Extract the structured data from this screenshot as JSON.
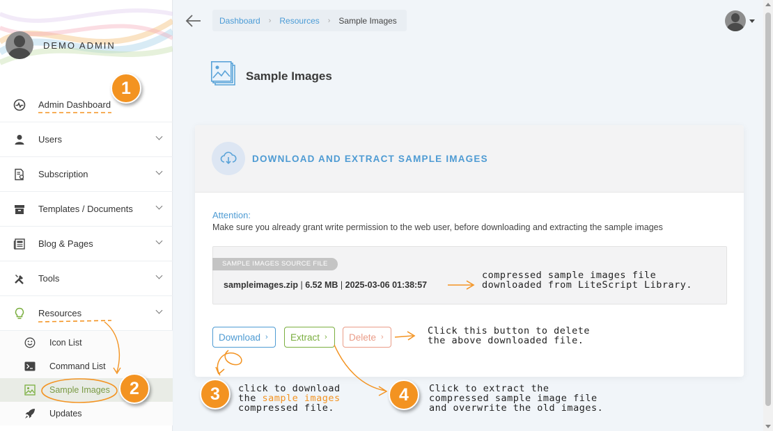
{
  "sidebar": {
    "profile_name": "DEMO ADMIN",
    "items": [
      {
        "label": "Admin Dashboard",
        "icon": "dashboard-icon"
      },
      {
        "label": "Users",
        "icon": "user-icon"
      },
      {
        "label": "Subscription",
        "icon": "subscription-icon"
      },
      {
        "label": "Templates / Documents",
        "icon": "archive-icon"
      },
      {
        "label": "Blog & Pages",
        "icon": "newspaper-icon"
      },
      {
        "label": "Tools",
        "icon": "tools-icon"
      },
      {
        "label": "Resources",
        "icon": "lightbulb-icon"
      }
    ],
    "sub_items": [
      {
        "label": "Icon List",
        "icon": "smiley-icon"
      },
      {
        "label": "Command List",
        "icon": "terminal-icon"
      },
      {
        "label": "Sample Images",
        "icon": "image-icon"
      },
      {
        "label": "Updates",
        "icon": "rocket-icon"
      }
    ]
  },
  "breadcrumb": {
    "items": [
      "Dashboard",
      "Resources"
    ],
    "current": "Sample Images"
  },
  "page": {
    "title": "Sample Images"
  },
  "card": {
    "title": "DOWNLOAD AND EXTRACT SAMPLE IMAGES",
    "attention_label": "Attention:",
    "attention_message": "Make sure you already grant write permission to the web user, before downloading and extracting the sample images",
    "source_tag": "SAMPLE IMAGES SOURCE FILE",
    "file_name": "sampleimages.zip",
    "file_size": "6.52 MB",
    "file_date": "2025-03-06 01:38:57",
    "buttons": {
      "download": "Download",
      "extract": "Extract",
      "delete": "Delete"
    }
  },
  "annotations": {
    "badges": [
      "1",
      "2",
      "3",
      "4"
    ],
    "file_note": [
      "compressed sample images file",
      "downloaded from LiteScript Library."
    ],
    "delete_note": [
      "Click this button to delete",
      "the above downloaded file."
    ],
    "download_note": {
      "line1": "click to download",
      "line2_prefix": "the ",
      "line2_highlight": "sample images",
      "line3": "compressed file."
    },
    "extract_note": [
      "Click to extract the",
      "compressed sample image file",
      "and overwrite the old images."
    ]
  },
  "colors": {
    "accent_blue": "#4e9bd3",
    "accent_green": "#7aae3f",
    "accent_red": "#ea9c88",
    "annotation_orange": "#f39321"
  }
}
